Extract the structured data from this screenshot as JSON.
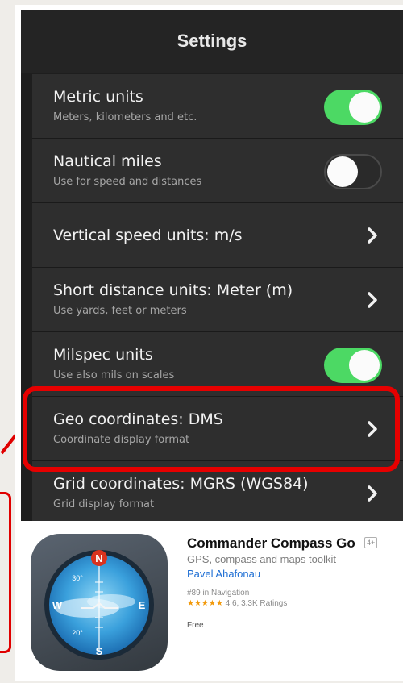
{
  "settings": {
    "title": "Settings",
    "rows": [
      {
        "title": "Metric units",
        "subtitle": "Meters, kilometers and etc."
      },
      {
        "title": "Nautical miles",
        "subtitle": "Use for speed and distances"
      },
      {
        "title": "Vertical speed units: m/s"
      },
      {
        "title": "Short distance units: Meter (m)",
        "subtitle": "Use yards, feet or meters"
      },
      {
        "title": "Milspec units",
        "subtitle": "Use also mils on scales"
      },
      {
        "title": "Geo coordinates: DMS",
        "subtitle": "Coordinate display format"
      },
      {
        "title": "Grid coordinates: MGRS (WGS84)",
        "subtitle": "Grid display format"
      }
    ]
  },
  "app": {
    "name": "Commander Compass Go",
    "age_rating": "4+",
    "subtitle": "GPS, compass and maps toolkit",
    "developer": "Pavel Ahafonau",
    "rank": "#89 in Navigation",
    "stars": "★★★★★",
    "rating": "4.6, 3.3K Ratings",
    "price": "Free",
    "icon_labels": {
      "north": "N",
      "south": "S",
      "west": "W",
      "east": "E",
      "angle_top": "30°",
      "angle_bottom": "20°"
    }
  },
  "colors": {
    "toggle_on": "#4cd964",
    "highlight": "#e60000",
    "link": "#1f6fd4",
    "stars": "#f29a0c"
  }
}
